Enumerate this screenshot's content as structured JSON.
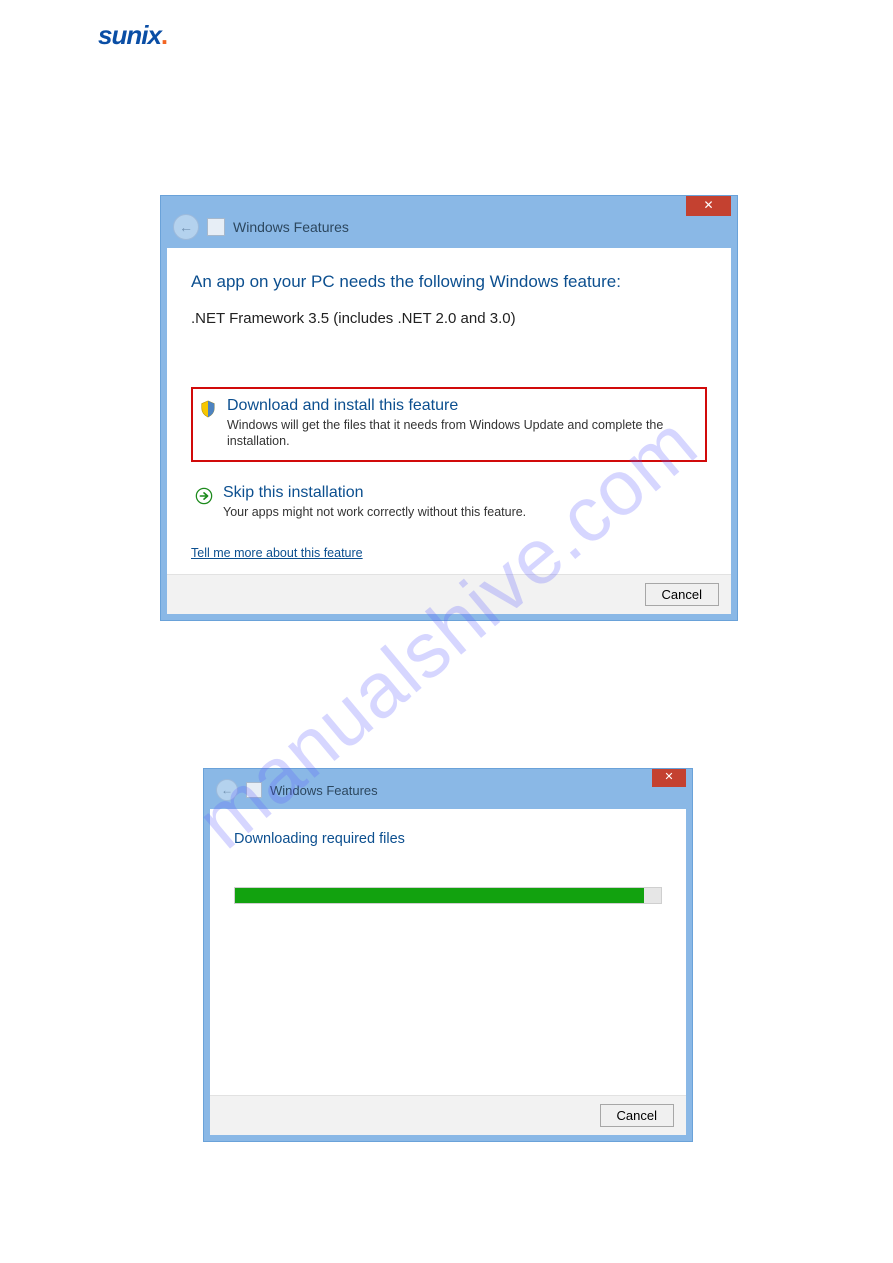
{
  "logo_text": "sunix",
  "watermark": "manualshive.com",
  "dialog1": {
    "header": "Windows Features",
    "heading": "An app on your PC needs the following Windows feature:",
    "feature_line": ".NET Framework 3.5 (includes .NET 2.0 and 3.0)",
    "opt_install_title": "Download and install this feature",
    "opt_install_desc": "Windows will get the files that it needs from Windows Update and complete the installation.",
    "opt_skip_title": "Skip this installation",
    "opt_skip_desc": "Your apps might not work correctly without this feature.",
    "more_link": "Tell me more about this feature",
    "cancel": "Cancel",
    "close_glyph": "✕"
  },
  "dialog2": {
    "header": "Windows Features",
    "status": "Downloading required files",
    "progress_percent": 96,
    "cancel": "Cancel",
    "close_glyph": "✕"
  }
}
